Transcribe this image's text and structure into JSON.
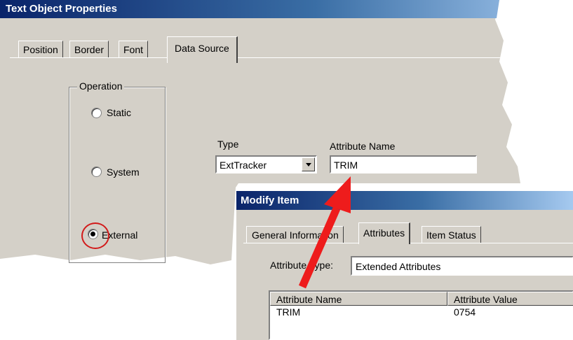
{
  "text_object_window": {
    "title": "Text Object Properties",
    "tabs": [
      {
        "label": "Position"
      },
      {
        "label": "Border"
      },
      {
        "label": "Font"
      },
      {
        "label": "Data Source"
      }
    ],
    "active_tab": "Data Source",
    "operation": {
      "group_label": "Operation",
      "options": [
        {
          "label": "Static",
          "selected": false
        },
        {
          "label": "System",
          "selected": false
        },
        {
          "label": "External",
          "selected": true
        }
      ]
    },
    "type_label": "Type",
    "type_value": "ExtTracker",
    "attribute_name_label": "Attribute Name",
    "attribute_name_value": "TRIM"
  },
  "modify_item_window": {
    "title": "Modify Item",
    "tabs": [
      {
        "label": "General Information"
      },
      {
        "label": "Attributes"
      },
      {
        "label": "Item Status"
      }
    ],
    "active_tab": "Attributes",
    "attribute_type_label": "Attribute Type:",
    "attribute_type_value": "Extended Attributes",
    "table": {
      "columns": [
        "Attribute Name",
        "Attribute Value"
      ],
      "rows": [
        [
          "TRIM",
          "0754"
        ]
      ]
    }
  },
  "annotation": {
    "arrow_color": "#ee1c1c",
    "circle_color": "#d21a1a"
  }
}
